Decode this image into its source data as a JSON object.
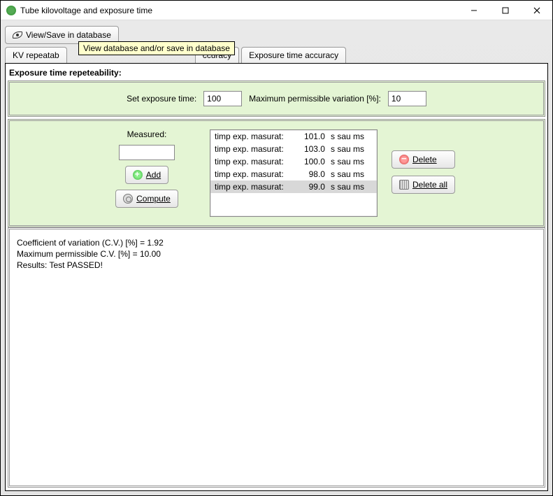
{
  "window": {
    "title": "Tube kilovoltage and exposure time"
  },
  "toolbar": {
    "viewSave": "View/Save in database",
    "tooltip": "View database and/or save in database"
  },
  "tabs": {
    "t0": "KV repeatab",
    "t2": "ccuracy",
    "t3": "Exposure time accuracy"
  },
  "group": {
    "title": "Exposure time repeteability:"
  },
  "params": {
    "setExpLabel": "Set exposure time:",
    "setExpValue": "100",
    "maxVarLabel": "Maximum permissible variation [%]:",
    "maxVarValue": "10"
  },
  "measured": {
    "label": "Measured:",
    "value": "",
    "addLabel": "Add",
    "computeLabel": "Compute"
  },
  "list": {
    "rows": [
      {
        "a": "timp exp. masurat:",
        "b": "101.0",
        "c": "s sau ms"
      },
      {
        "a": "timp exp. masurat:",
        "b": "103.0",
        "c": "s sau ms"
      },
      {
        "a": "timp exp. masurat:",
        "b": "100.0",
        "c": "s sau ms"
      },
      {
        "a": "timp exp. masurat:",
        "b": "98.0",
        "c": "s sau ms"
      },
      {
        "a": "timp exp. masurat:",
        "b": "99.0",
        "c": "s sau ms"
      }
    ],
    "selectedIndex": 4
  },
  "delete": {
    "del": "Delete",
    "delAll": "Delete all"
  },
  "results": {
    "l1": "Coefficient of variation (C.V.) [%] = 1.92",
    "l2": "Maximum permissible C.V. [%] = 10.00",
    "l3": "Results:  Test PASSED!"
  }
}
